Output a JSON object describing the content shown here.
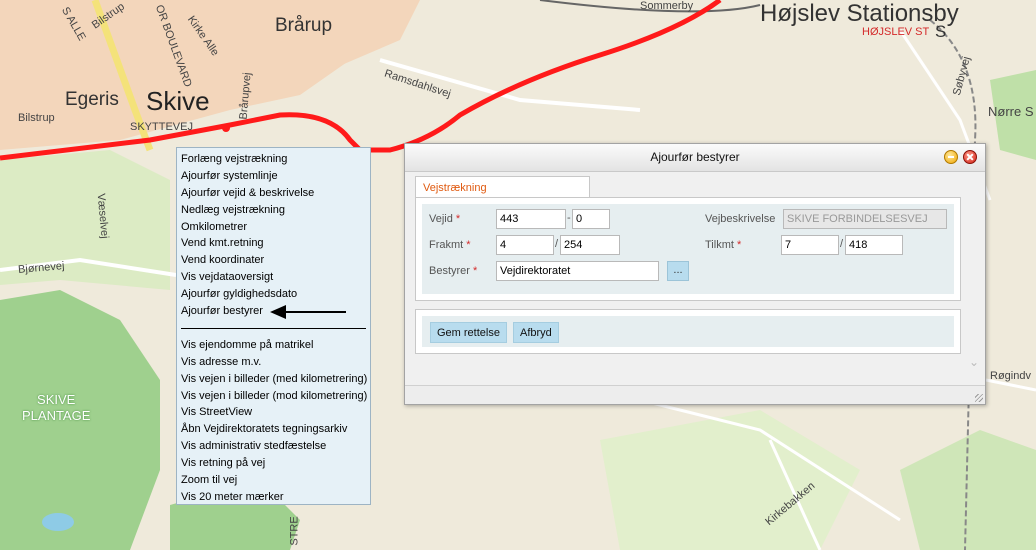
{
  "map": {
    "towns": {
      "skive": "Skive",
      "egeris": "Egeris",
      "braarup": "Brårup",
      "hojslev": "Højslev Stationsby",
      "norre": "Nørre S",
      "plantage": "SKIVE\nPLANTAGE",
      "station_code": "HØJSLEV ST",
      "station_s": "S"
    },
    "roads": {
      "bilstrup_top": "Bilstrup",
      "bilstrup_left": "Bilstrup",
      "alle": "S ALLE",
      "boulevard": "OR BOULEVARD",
      "kirke_alle": "Kirke Alle",
      "braarupvej": "Brårupvej",
      "skyttevej": "SKYTTEVEJ",
      "ramsdahlsvej": "Ramsdahlsvej",
      "soebyvej": "Søbyvej",
      "vaeselvej": "Væselvej",
      "bjornevej": "Bjørnevej",
      "kirkebakken": "Kirkebakken",
      "rogind": "Røgindv",
      "sommerby": "Sommerby",
      "stre": "STRE"
    }
  },
  "context_menu": {
    "group1": [
      "Forlæng vejstrækning",
      "Ajourfør systemlinje",
      "Ajourfør vejid & beskrivelse",
      "Nedlæg vejstrækning",
      "Omkilometrer",
      "Vend kmt.retning",
      "Vend koordinater",
      "Vis vejdataoversigt",
      "Ajourfør gyldighedsdato",
      "Ajourfør bestyrer"
    ],
    "group2": [
      "Vis ejendomme på matrikel",
      "Vis adresse m.v.",
      "Vis vejen i billeder (med kilometrering)",
      "Vis vejen i billeder (mod kilometrering)",
      "Vis StreetView",
      "Åbn Vejdirektoratets tegningsarkiv",
      "Vis administrativ stedfæstelse",
      "Vis retning på vej",
      "Zoom til vej",
      "Vis 20 meter mærker"
    ]
  },
  "dialog": {
    "title": "Ajourfør bestyrer",
    "tab": "Vejstrækning",
    "fields": {
      "vejid_label": "Vejid",
      "vejid_value": "443",
      "vejid_sep": "-",
      "vejid_sub": "0",
      "vejbeskrivelse_label": "Vejbeskrivelse",
      "vejbeskrivelse_value": "SKIVE FORBINDELSESVEJ",
      "frakmt_label": "Frakmt",
      "frakmt_km": "4",
      "frakmt_m": "254",
      "tilkmt_label": "Tilkmt",
      "tilkmt_km": "7",
      "tilkmt_m": "418",
      "slash": "/",
      "bestyrer_label": "Bestyrer",
      "bestyrer_value": "Vejdirektoratet",
      "required_mark": "*",
      "dots_label": "..."
    },
    "buttons": {
      "save": "Gem rettelse",
      "cancel": "Afbryd"
    },
    "scroll_arrow": "⌄"
  },
  "colors": {
    "route": "#ff1a1a",
    "menu_bg": "#e6f1f7",
    "tab_text": "#e05a10",
    "required": "#d42a2a",
    "button_bg": "#b8dcee"
  }
}
